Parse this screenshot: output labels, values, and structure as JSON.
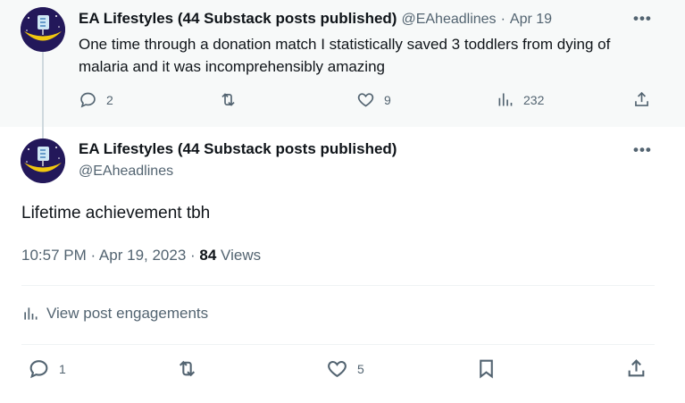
{
  "parent": {
    "name": "EA Lifestyles (44 Substack posts published)",
    "handle": "@EAheadlines",
    "dot": "·",
    "date": "Apr 19",
    "text": "One time through a donation match I statistically saved 3 toddlers from dying of malaria and it was incomprehensibly amazing",
    "more": "•••",
    "replies": "2",
    "reposts": "",
    "likes": "9",
    "views": "232"
  },
  "main": {
    "name": "EA Lifestyles (44 Substack posts published)",
    "handle": "@EAheadlines",
    "more": "•••",
    "text": "Lifetime achievement tbh",
    "time": "10:57 PM · Apr 19, 2023 · ",
    "view_count": "84",
    "views_label": " Views",
    "engagements_label": "View post engagements",
    "replies": "1",
    "likes": "5"
  },
  "icons": {
    "reply": "reply-icon",
    "repost": "repost-icon",
    "like": "heart-icon",
    "views": "analytics-icon",
    "share": "share-icon",
    "bookmark": "bookmark-icon",
    "more": "more-icon",
    "avatar": "avatar"
  },
  "colors": {
    "text_primary": "#0f1419",
    "text_secondary": "#536471",
    "parent_bg": "#f7f9f9",
    "divider": "#eff3f4"
  }
}
